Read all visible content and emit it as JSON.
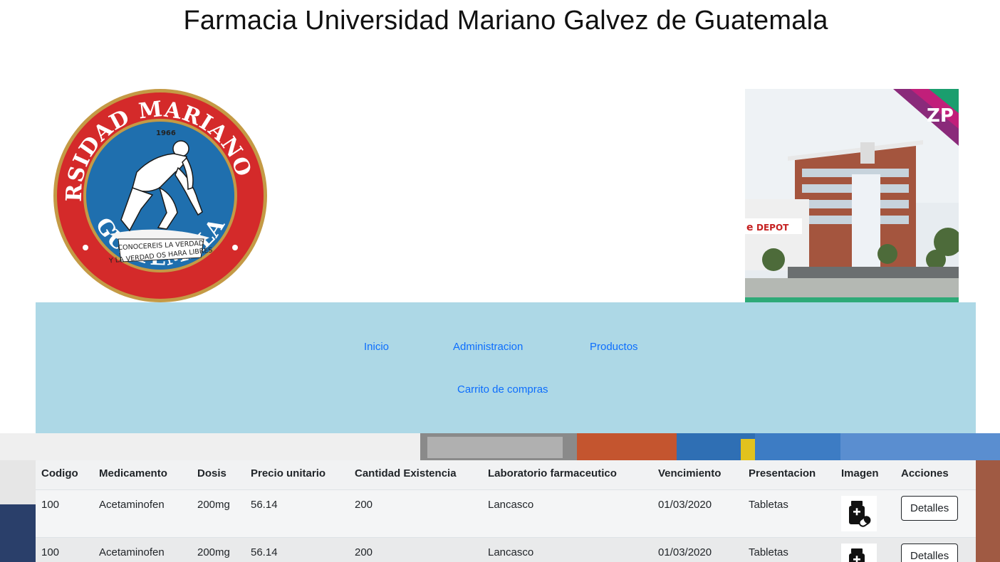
{
  "page": {
    "title": "Farmacia Universidad Mariano Galvez de Guatemala"
  },
  "logo": {
    "text_top": "UNIVERSIDAD MARIANO GALVEZ",
    "text_bottom": "GUATEMALA",
    "year": "1966",
    "motto_line1": "CONOCEREIS LA VERDAD",
    "motto_line2": "Y LA VERDAD OS HARA LIBRES",
    "colors": {
      "ring": "#d42a2a",
      "inner": "#1f6fae",
      "gold": "#b8923a"
    }
  },
  "photo": {
    "sign_text": "DEPOT",
    "badge_text": "ZP"
  },
  "nav": {
    "items": [
      {
        "label": "Inicio"
      },
      {
        "label": "Administracion"
      },
      {
        "label": "Productos"
      },
      {
        "label": "Carrito de compras"
      }
    ],
    "background": "#add8e6",
    "link_color": "#0d6efd"
  },
  "table": {
    "headers": [
      "Codigo",
      "Medicamento",
      "Dosis",
      "Precio unitario",
      "Cantidad Existencia",
      "Laboratorio farmaceutico",
      "Vencimiento",
      "Presentacion",
      "Imagen",
      "Acciones"
    ],
    "rows": [
      {
        "codigo": "100",
        "medicamento": "Acetaminofen",
        "dosis": "200mg",
        "precio": "56.14",
        "cantidad": "200",
        "laboratorio": "Lancasco",
        "vencimiento": "01/03/2020",
        "presentacion": "Tabletas",
        "imagen_icon": "medicine-bottle-icon",
        "accion": "Detalles"
      },
      {
        "codigo": "100",
        "medicamento": "Acetaminofen",
        "dosis": "200mg",
        "precio": "56.14",
        "cantidad": "200",
        "laboratorio": "Lancasco",
        "vencimiento": "01/03/2020",
        "presentacion": "Tabletas",
        "imagen_icon": "medicine-bottle-icon",
        "accion": "Detalles"
      }
    ]
  }
}
